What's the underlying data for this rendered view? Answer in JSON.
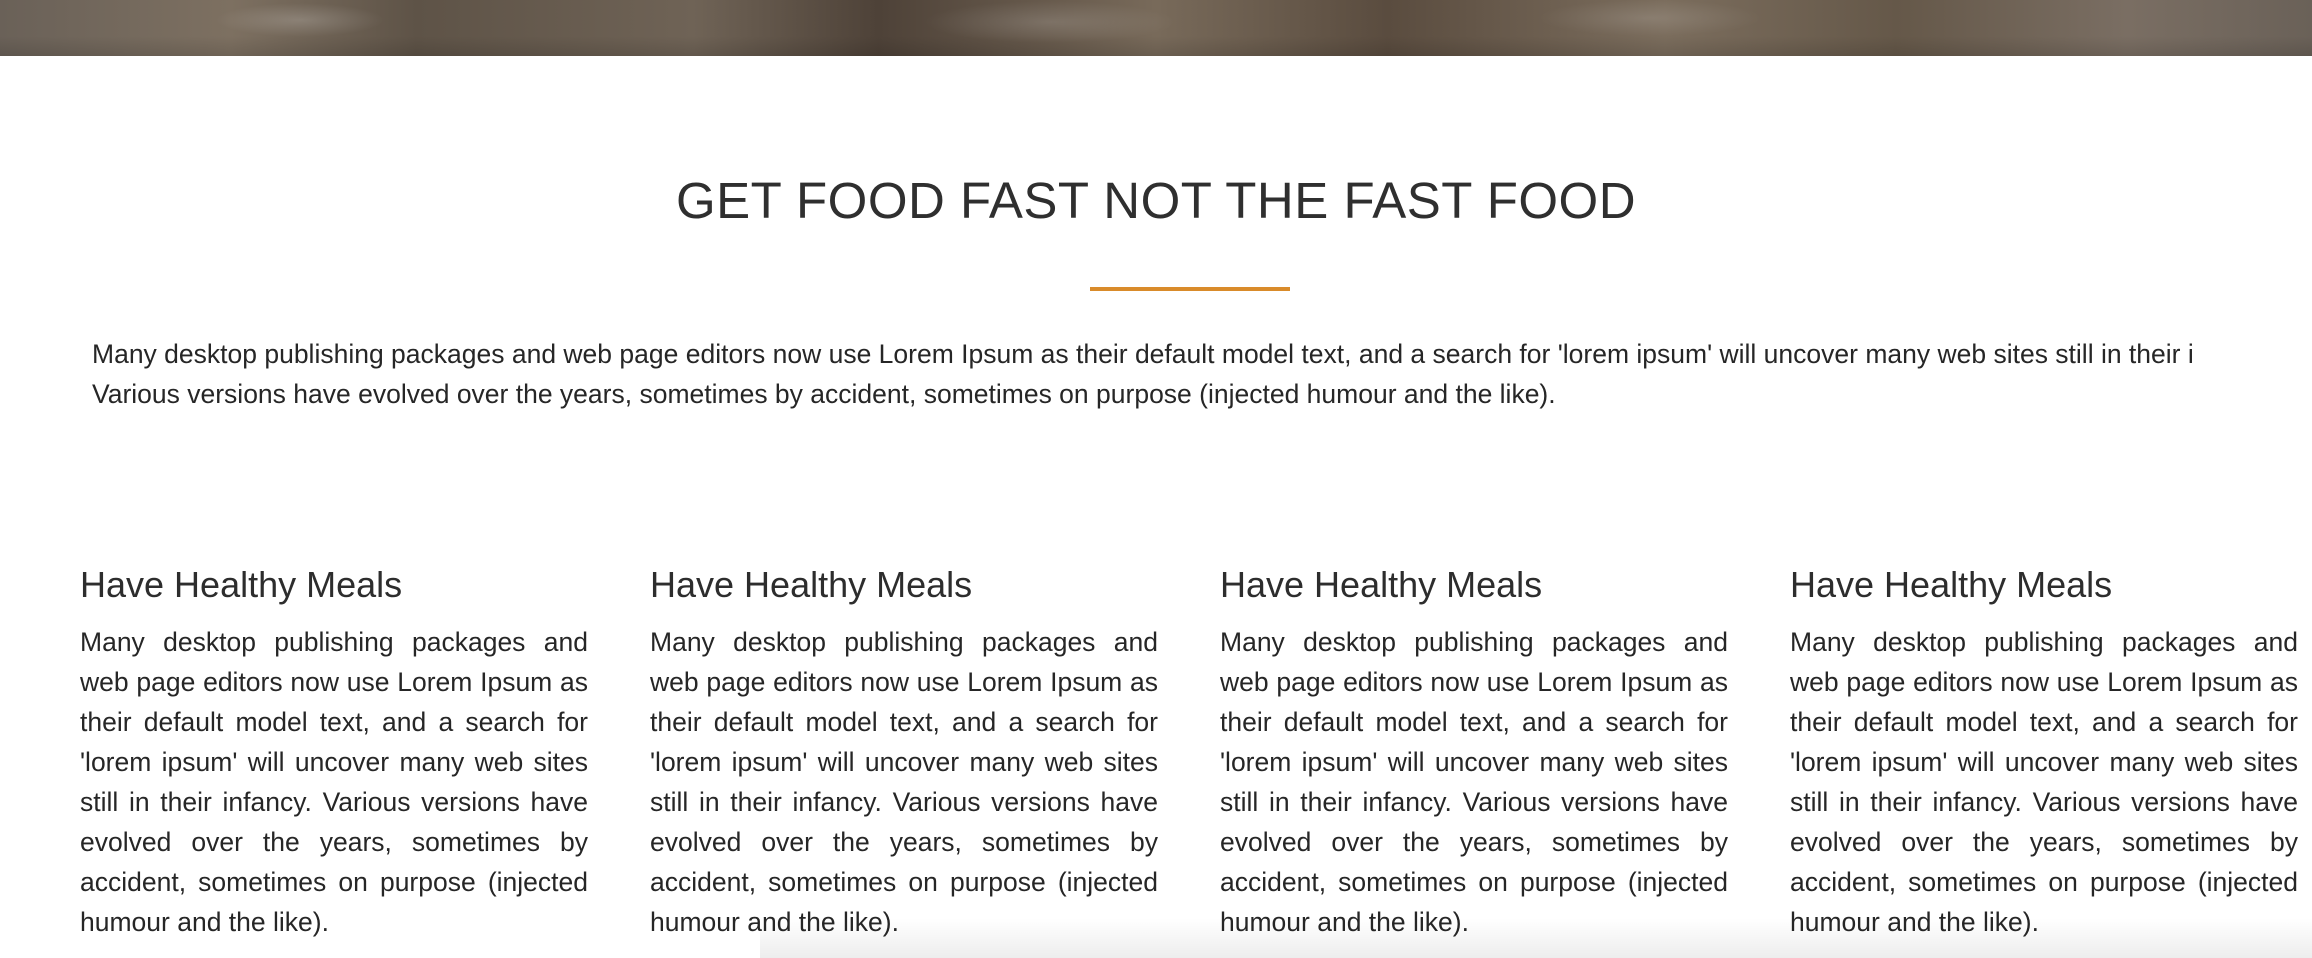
{
  "hero": {
    "image": "restaurant-hero-photo"
  },
  "section": {
    "title": "GET FOOD FAST NOT THE FAST FOOD",
    "accent_color": "#d98b2a",
    "intro_lines": [
      "Many desktop publishing packages and web page editors now use Lorem Ipsum as their default model text, and a search for 'lorem ipsum' will uncover many web sites still in their i",
      "Various versions have evolved over the years, sometimes by accident, sometimes on purpose (injected humour and the like)."
    ]
  },
  "features": [
    {
      "title": "Have Healthy Meals",
      "text": "Many desktop publishing packages and web page editors now use Lorem Ipsum as their default model text, and a search for 'lorem ipsum' will uncover many web sites still in their infancy. Various versions have evolved over the years, sometimes by accident, sometimes on purpose (injected humour and the like)."
    },
    {
      "title": "Have Healthy Meals",
      "text": "Many desktop publishing packages and web page editors now use Lorem Ipsum as their default model text, and a search for 'lorem ipsum' will uncover many web sites still in their infancy. Various versions have evolved over the years, sometimes by accident, sometimes on purpose (injected humour and the like)."
    },
    {
      "title": "Have Healthy Meals",
      "text": "Many desktop publishing packages and web page editors now use Lorem Ipsum as their default model text, and a search for 'lorem ipsum' will uncover many web sites still in their infancy. Various versions have evolved over the years, sometimes by accident, sometimes on purpose (injected humour and the like)."
    },
    {
      "title": "Have Healthy Meals",
      "text": "Many desktop publishing packages and web page editors now use Lorem Ipsum as their default model text, and a search for 'lorem ipsum' will uncover many web sites still in their infancy. Various versions have evolved over the years, sometimes by accident, sometimes on purpose (injected humour and the like)."
    }
  ]
}
